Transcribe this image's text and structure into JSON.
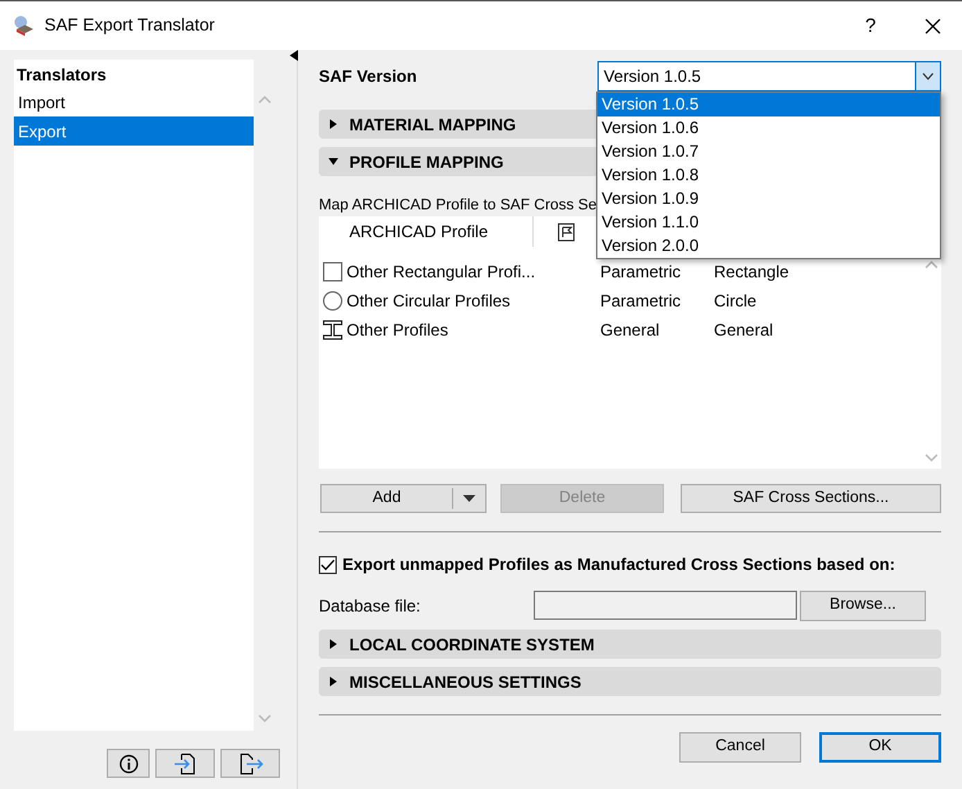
{
  "window": {
    "title": "SAF Export Translator",
    "help": "?"
  },
  "sidebar": {
    "header": "Translators",
    "items": [
      {
        "label": "Import",
        "selected": false
      },
      {
        "label": "Export",
        "selected": true
      }
    ]
  },
  "saf_version": {
    "label": "SAF Version",
    "value": "Version 1.0.5",
    "dropdown": {
      "options": [
        {
          "label": "Version 1.0.5",
          "selected": true
        },
        {
          "label": "Version 1.0.6",
          "selected": false
        },
        {
          "label": "Version 1.0.7",
          "selected": false
        },
        {
          "label": "Version 1.0.8",
          "selected": false
        },
        {
          "label": "Version 1.0.9",
          "selected": false
        },
        {
          "label": "Version 1.1.0",
          "selected": false
        },
        {
          "label": "Version 2.0.0",
          "selected": false
        }
      ]
    }
  },
  "material_mapping": {
    "title": "MATERIAL MAPPING",
    "expanded": false
  },
  "profile_mapping": {
    "title": "PROFILE MAPPING",
    "expanded": true,
    "description": "Map ARCHICAD Profile to SAF Cross Se",
    "table": {
      "columns": [
        "ARCHICAD Profile"
      ],
      "rows": [
        {
          "kind": "rectangle",
          "name": "Other Rectangular Profi...",
          "type": "Parametric",
          "shape": "Rectangle"
        },
        {
          "kind": "circle",
          "name": "Other Circular Profiles",
          "type": "Parametric",
          "shape": "Circle"
        },
        {
          "kind": "ibeam",
          "name": "Other Profiles",
          "type": "General",
          "shape": "General"
        }
      ]
    },
    "buttons": [
      {
        "kind": "split",
        "label": "Add",
        "disabled": false
      },
      {
        "kind": "plain",
        "label": "Delete",
        "disabled": true
      },
      {
        "kind": "plain",
        "label": "SAF Cross Sections...",
        "disabled": false
      }
    ]
  },
  "export_unmapped": {
    "label": "Export unmapped Profiles as Manufactured Cross Sections based on:",
    "checked": true
  },
  "database_file": {
    "label": "Database file:",
    "button": "Browse..."
  },
  "sections": [
    {
      "title": "LOCAL COORDINATE SYSTEM",
      "expanded": false
    },
    {
      "title": "MISCELLANEOUS SETTINGS",
      "expanded": false
    }
  ],
  "footer": {
    "buttons": [
      {
        "label": "Cancel",
        "default": false
      },
      {
        "label": "OK",
        "default": true
      }
    ]
  }
}
